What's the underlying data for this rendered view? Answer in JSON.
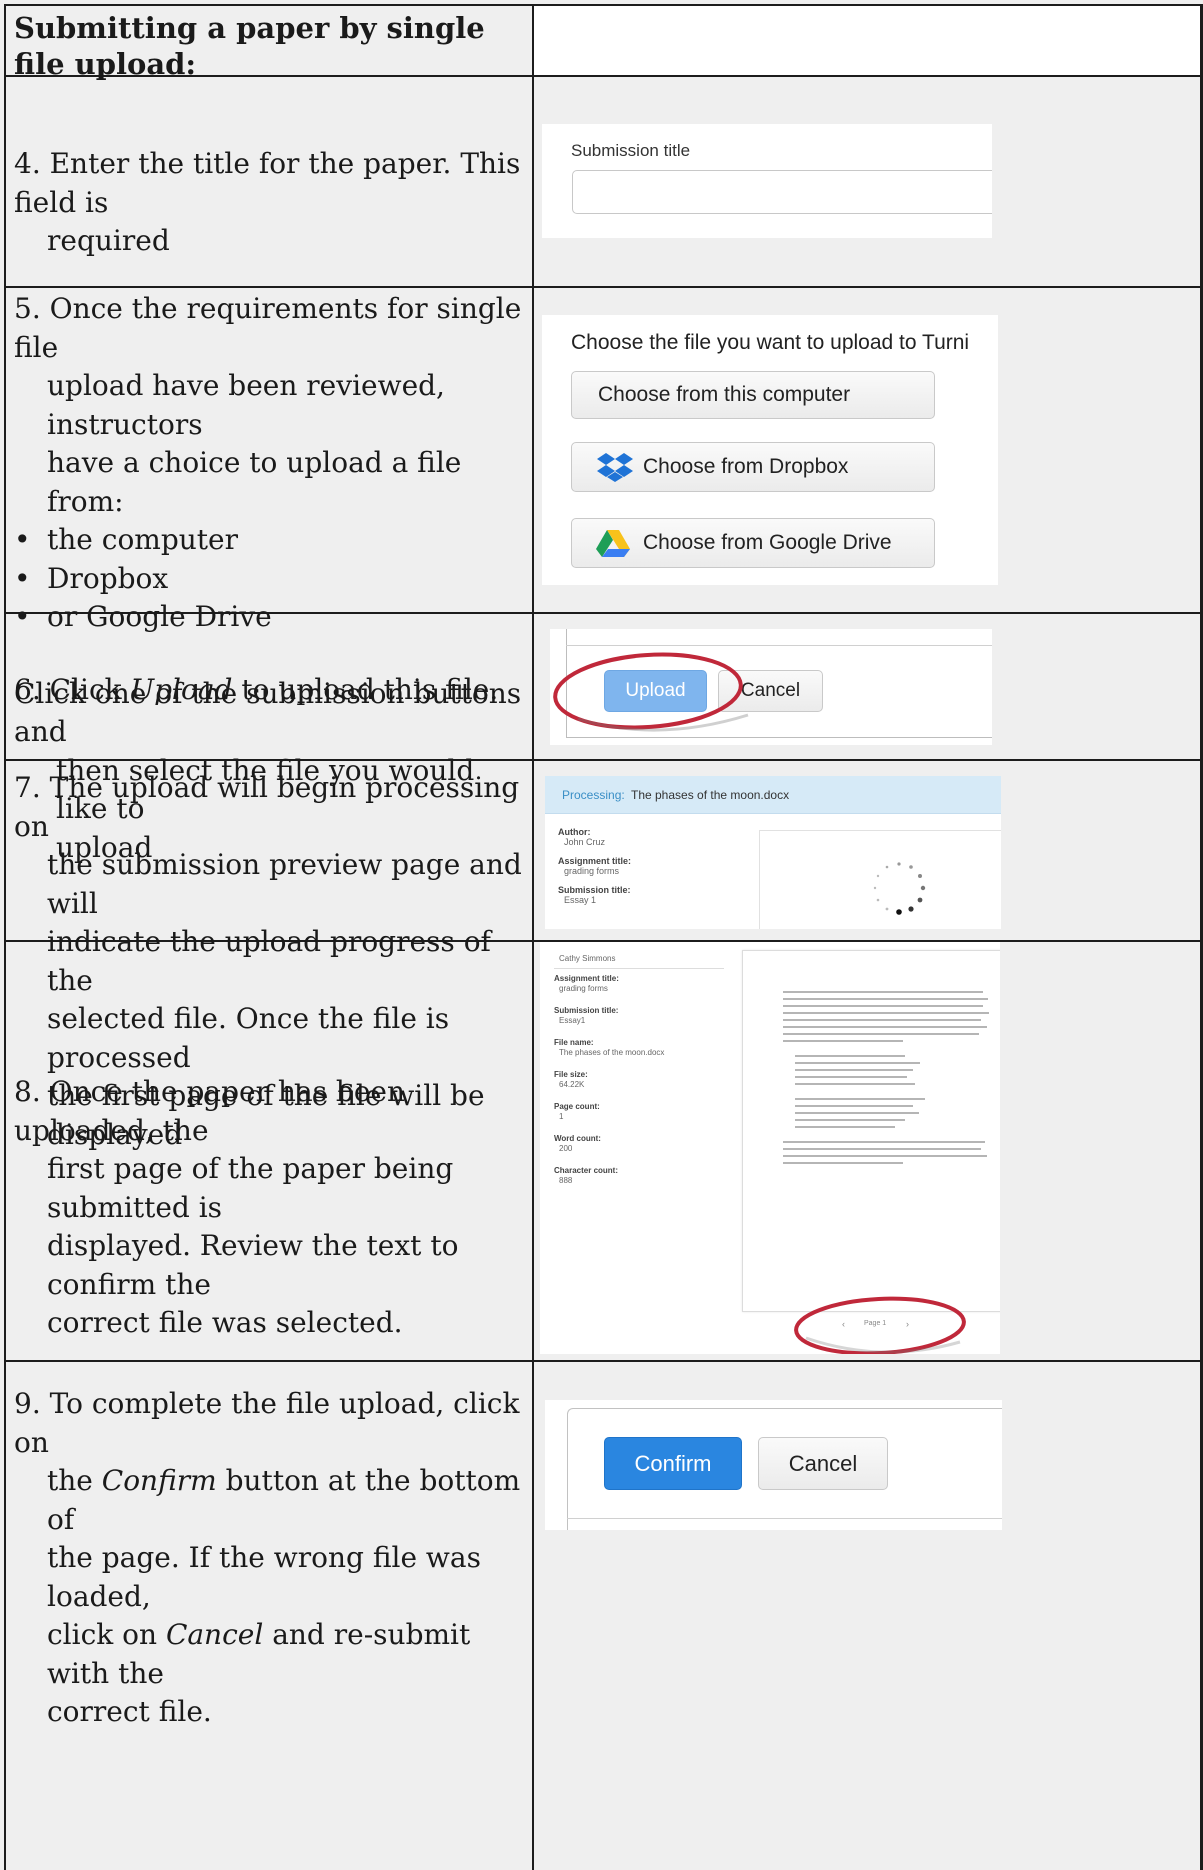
{
  "header": {
    "title": "Submitting a paper by single file upload:"
  },
  "steps": {
    "s4": {
      "text_line1": "4. Enter the title for the paper. This field is",
      "text_line2": "required",
      "shot": {
        "field_label": "Submission title",
        "field_value": ""
      }
    },
    "s5": {
      "line1": "5. Once the requirements for single file",
      "line2": "upload have been reviewed, instructors",
      "line3": "have a choice to upload a file from:",
      "bullets": [
        "the computer",
        "Dropbox",
        "or Google Drive"
      ],
      "para2_line1": "Click one of the submission buttons and",
      "para2_line2": "then select the file you would like to",
      "para2_line3": "upload",
      "shot": {
        "heading": "Choose the file you want to upload to Turni",
        "btn_computer": "Choose from this computer",
        "btn_dropbox": "Choose from Dropbox",
        "btn_gdrive": "Choose from Google Drive"
      }
    },
    "s6": {
      "prefix": "6. Click ",
      "em": "Upload",
      "suffix": " to upload this file.",
      "shot": {
        "upload": "Upload",
        "cancel": "Cancel"
      }
    },
    "s7": {
      "line1": "7. The upload will begin processing on",
      "line2": "the submission preview page and will",
      "line3": "indicate the upload progress of the",
      "line4": "selected file. Once the file is processed",
      "line5": "the first page of the file will be displayed",
      "shot": {
        "processing_label": "Processing:",
        "processing_file": "The phases of the moon.docx",
        "author_label": "Author:",
        "author_value": "John Cruz",
        "assignment_label": "Assignment title:",
        "assignment_value": "grading forms",
        "submission_label": "Submission title:",
        "submission_value": "Essay 1"
      }
    },
    "s8": {
      "line1": "8. Once the paper has been uploaded, the",
      "line2": "first page of the paper being submitted is",
      "line3": "displayed. Review the text to confirm the",
      "line4": "correct file was selected.",
      "shot": {
        "author_value": "Cathy Simmons",
        "assignment_label": "Assignment title:",
        "assignment_value": "grading forms",
        "submission_label": "Submission title:",
        "submission_value": "Essay1",
        "filename_label": "File name:",
        "filename_value": "The phases of the moon.docx",
        "filesize_label": "File size:",
        "filesize_value": "64.22K",
        "pagecount_label": "Page count:",
        "pagecount_value": "1",
        "wordcount_label": "Word count:",
        "wordcount_value": "200",
        "charcount_label": "Character count:",
        "charcount_value": "888",
        "pager_prev": "‹",
        "pager_label": "Page 1",
        "pager_next": "›"
      }
    },
    "s9": {
      "line1": "9. To complete the file upload, click on",
      "line2_prefix": "the ",
      "line2_em": "Confirm",
      "line2_suffix": " button at the bottom of",
      "line3": "the page. If the wrong file was loaded,",
      "line4_prefix": "click on ",
      "line4_em": "Cancel",
      "line4_suffix": " and re-submit with the",
      "line5": "correct file.",
      "shot": {
        "confirm": "Confirm",
        "cancel": "Cancel"
      }
    }
  },
  "colors": {
    "cell_bg": "#efefef",
    "border": "#1c1c1c",
    "highlight_circle": "#c0283a",
    "primary_button": "#2a86e0",
    "upload_button": "#7fb5ee",
    "processing_bar": "#d6eaf7"
  }
}
